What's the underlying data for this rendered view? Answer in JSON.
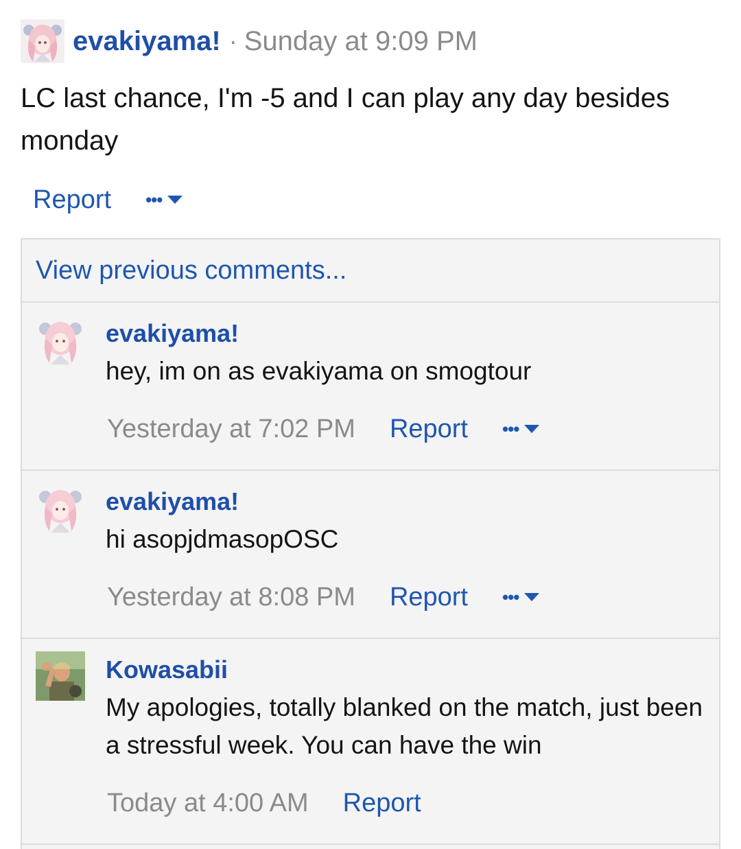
{
  "post": {
    "author": "evakiyama!",
    "separator": "·",
    "time": "Sunday at 9:09 PM",
    "body": "LC last chance, I'm -5 and I can play any day besides monday",
    "report_label": "Report",
    "more_label": "•••"
  },
  "comments_section": {
    "view_previous": "View previous comments...",
    "items": [
      {
        "author": "evakiyama!",
        "text": "hey, im on as evakiyama on smogtour",
        "time": "Yesterday at 7:02 PM",
        "report_label": "Report",
        "more_label": "•••"
      },
      {
        "author": "evakiyama!",
        "text": "hi asopjdmasopOSC",
        "time": "Yesterday at 8:08 PM",
        "report_label": "Report",
        "more_label": "•••"
      },
      {
        "author": "Kowasabii",
        "text": "My apologies, totally blanked on the match, just been a stressful week. You can have the win",
        "time": "Today at 4:00 AM",
        "report_label": "Report"
      }
    ]
  },
  "colors": {
    "author_link": "#1e4fa8",
    "link": "#1e56b0",
    "muted": "#8a8a8a",
    "panel_bg": "#f4f4f4",
    "border": "#dcdcdc"
  }
}
